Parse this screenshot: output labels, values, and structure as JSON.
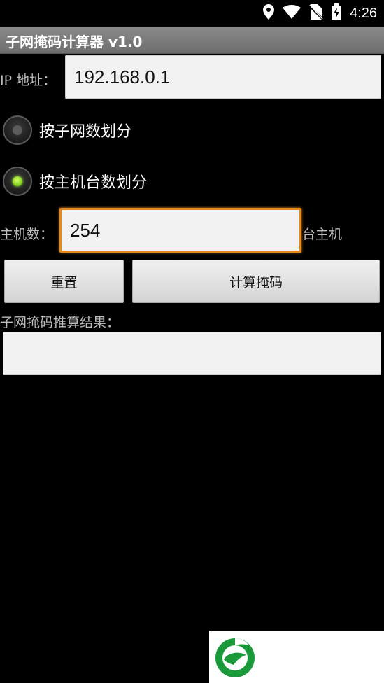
{
  "status_bar": {
    "time": "4:26",
    "icons": [
      "location-icon",
      "wifi-icon",
      "no-sim-icon",
      "battery-charging-icon"
    ]
  },
  "app": {
    "title": "子网掩码计算器 v1.0"
  },
  "ip": {
    "label": "IP 地址：",
    "value": "192.168.0.1"
  },
  "mode": {
    "options": [
      {
        "label": "按子网数划分",
        "checked": false
      },
      {
        "label": "按主机台数划分",
        "checked": true
      }
    ]
  },
  "hosts": {
    "label": "主机数：",
    "value": "254",
    "suffix": "台主机"
  },
  "buttons": {
    "reset": "重置",
    "calculate": "计算掩码"
  },
  "result": {
    "label": "子网掩码推算结果：",
    "value": ""
  },
  "colors": {
    "accent_focus": "#e38a1a",
    "radio_checked": "#7acb15",
    "logo_green": "#1a9a3a"
  }
}
